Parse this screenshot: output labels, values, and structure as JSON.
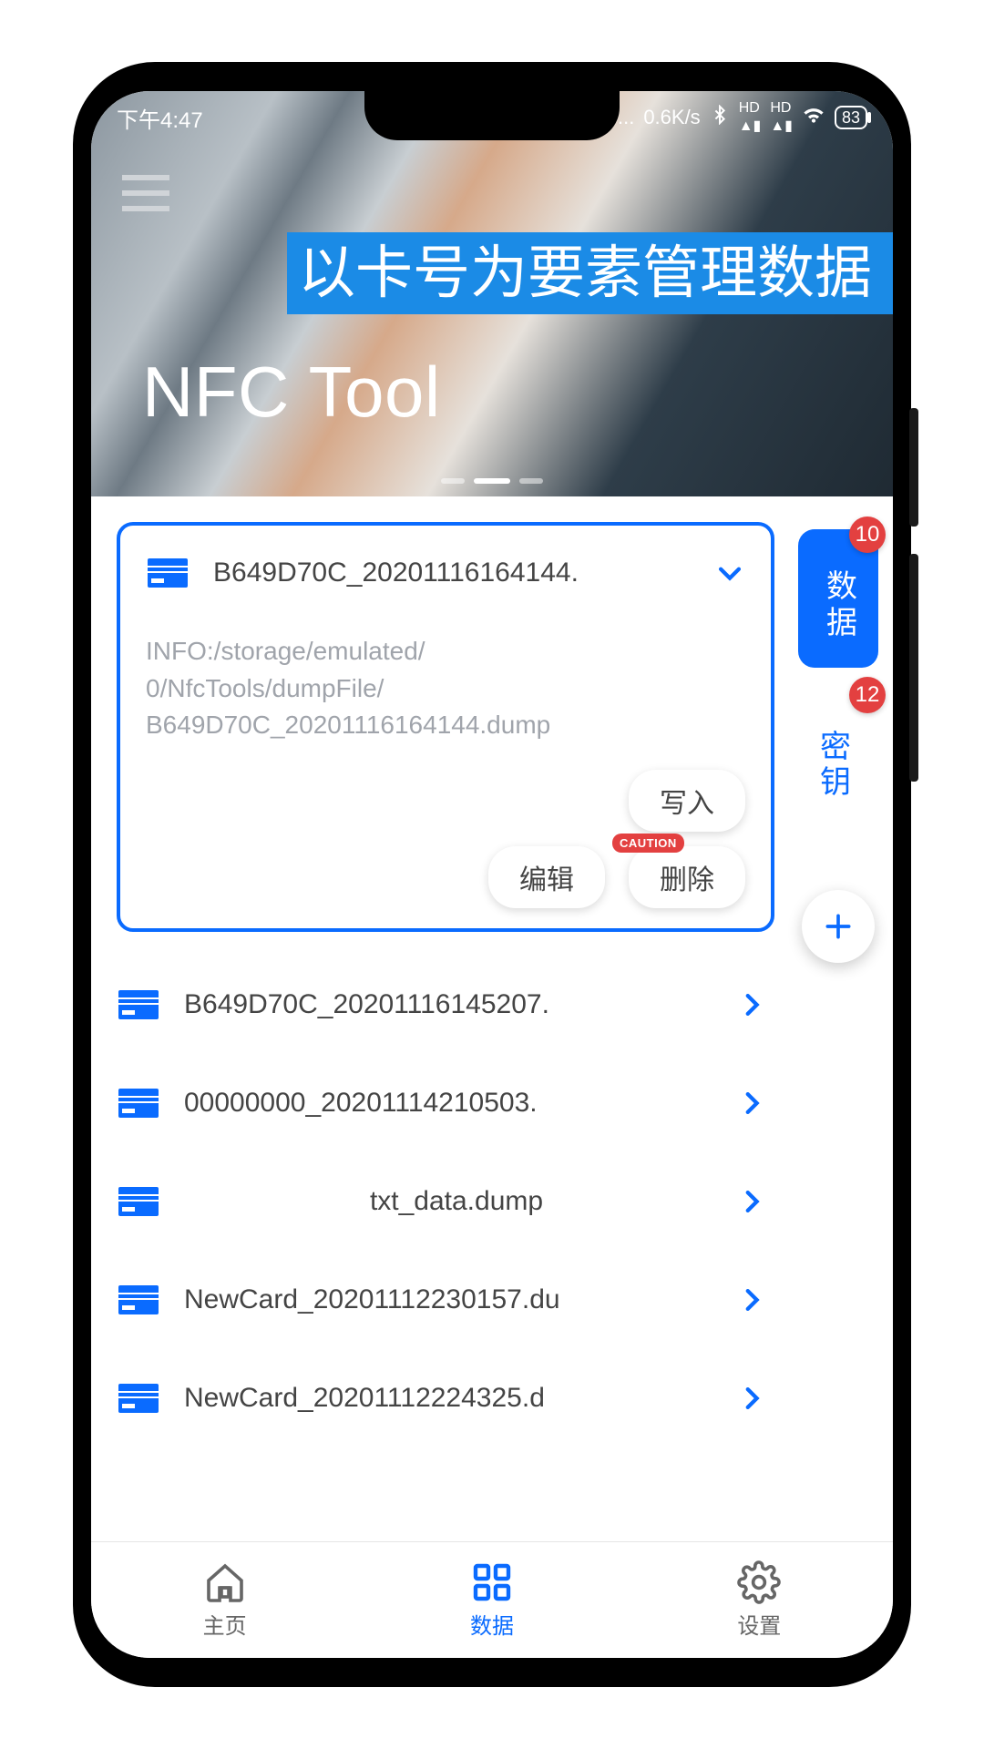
{
  "banner_text": "以卡号为要素管理数据",
  "status_bar": {
    "time": "下午4:47",
    "net_speed": "0.6K/s",
    "battery_pct": "83"
  },
  "hero": {
    "title": "NFC Tool"
  },
  "expanded_card": {
    "filename": "B649D70C_20201116164144.",
    "info_line1": "INFO:/storage/emulated/",
    "info_line2": "0/NfcTools/dumpFile/",
    "info_line3": "B649D70C_20201116164144.dump",
    "btn_write": "写入",
    "btn_edit": "编辑",
    "btn_delete": "删除",
    "caution_label": "CAUTION"
  },
  "list_items": [
    {
      "filename": "B649D70C_20201116145207."
    },
    {
      "filename": "00000000_20201114210503."
    },
    {
      "filename": "txt_data.dump"
    },
    {
      "filename": "NewCard_20201112230157.du"
    },
    {
      "filename": "NewCard_20201112224325.d"
    }
  ],
  "side_tabs": {
    "data": {
      "label": "数据",
      "badge": "10"
    },
    "keys": {
      "label_1": "密",
      "label_2": "钥",
      "badge": "12"
    }
  },
  "bottom_nav": {
    "home": "主页",
    "data": "数据",
    "settings": "设置"
  }
}
